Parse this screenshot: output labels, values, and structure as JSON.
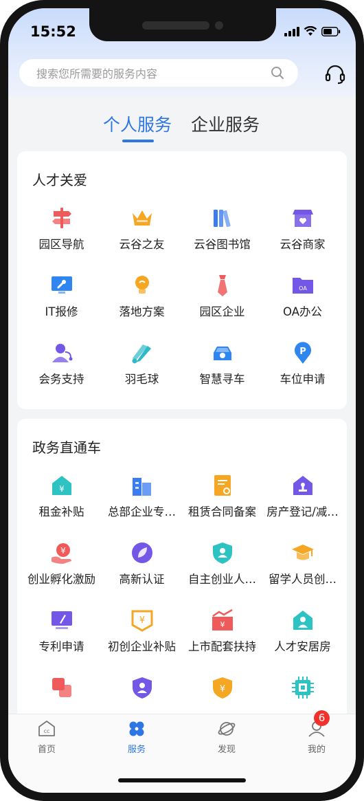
{
  "status_bar": {
    "time": "15:52"
  },
  "search": {
    "placeholder": "搜索您所需要的服务内容"
  },
  "tabs": [
    {
      "label": "个人服务",
      "active": true
    },
    {
      "label": "企业服务",
      "active": false
    }
  ],
  "sections": [
    {
      "title": "人才关爱",
      "items": [
        {
          "label": "园区导航",
          "icon": "signpost-icon",
          "color": "#ef5a5a"
        },
        {
          "label": "云谷之友",
          "icon": "crown-icon",
          "color": "#f5a623"
        },
        {
          "label": "云谷图书馆",
          "icon": "books-icon",
          "color": "#3b7cf2"
        },
        {
          "label": "云谷商家",
          "icon": "shop-icon",
          "color": "#7357e6"
        },
        {
          "label": "IT报修",
          "icon": "monitor-wrench-icon",
          "color": "#2f86f0"
        },
        {
          "label": "落地方案",
          "icon": "lightbulb-icon",
          "color": "#f5a623"
        },
        {
          "label": "园区企业",
          "icon": "tie-icon",
          "color": "#ef5a5a"
        },
        {
          "label": "OA办公",
          "icon": "oa-folder-icon",
          "color": "#7357e6"
        },
        {
          "label": "会务支持",
          "icon": "user-headset-icon",
          "color": "#7357e6"
        },
        {
          "label": "羽毛球",
          "icon": "shuttlecock-icon",
          "color": "#2eb9c8"
        },
        {
          "label": "智慧寻车",
          "icon": "car-icon",
          "color": "#2f86f0"
        },
        {
          "label": "车位申请",
          "icon": "parking-pin-icon",
          "color": "#2f86f0"
        }
      ]
    },
    {
      "title": "政务直通车",
      "items": [
        {
          "label": "租金补贴",
          "icon": "house-yen-icon",
          "color": "#2ec3c3"
        },
        {
          "label": "总部企业专…",
          "icon": "buildings-icon",
          "color": "#3b7cf2"
        },
        {
          "label": "租赁合同备案",
          "icon": "contract-icon",
          "color": "#f5a623"
        },
        {
          "label": "房产登记/减…",
          "icon": "house-stamp-icon",
          "color": "#7357e6"
        },
        {
          "label": "创业孵化激励",
          "icon": "hand-yen-icon",
          "color": "#ef5a5a"
        },
        {
          "label": "高新认证",
          "icon": "leaf-badge-icon",
          "color": "#7357e6"
        },
        {
          "label": "自主创业人…",
          "icon": "shield-user-icon",
          "color": "#2ec3c3"
        },
        {
          "label": "留学人员创…",
          "icon": "graduation-cap-icon",
          "color": "#f5a623"
        },
        {
          "label": "专利申请",
          "icon": "monitor-pen-icon",
          "color": "#7357e6"
        },
        {
          "label": "初创企业补贴",
          "icon": "yen-frame-icon",
          "color": "#f5a623"
        },
        {
          "label": "上市配套扶持",
          "icon": "chart-yen-icon",
          "color": "#ef5a5a"
        },
        {
          "label": "人才安居房",
          "icon": "house-person-icon",
          "color": "#2ec3c3"
        },
        {
          "label": "",
          "icon": "squares-icon",
          "color": "#ef5a5a"
        },
        {
          "label": "",
          "icon": "shield-person-icon",
          "color": "#7357e6"
        },
        {
          "label": "",
          "icon": "shield-yen-icon",
          "color": "#f5a623"
        },
        {
          "label": "",
          "icon": "chip-icon",
          "color": "#2ec3c3"
        }
      ]
    }
  ],
  "bottom_nav": [
    {
      "label": "首页",
      "icon": "home-cc-icon",
      "active": false
    },
    {
      "label": "服务",
      "icon": "clover-icon",
      "active": true
    },
    {
      "label": "发现",
      "icon": "planet-icon",
      "active": false
    },
    {
      "label": "我的",
      "icon": "profile-icon",
      "active": false,
      "badge": "6"
    }
  ],
  "colors": {
    "accent": "#2f76e5",
    "badge": "#f1312b"
  }
}
